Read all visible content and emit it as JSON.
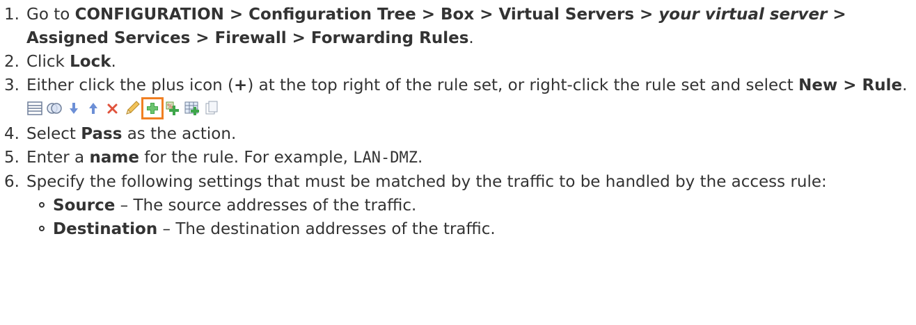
{
  "steps": [
    {
      "num": "1.",
      "lead": "Go to ",
      "path_bold_1": "CONFIGURATION > Configuration Tree > Box > Virtual Servers > ",
      "path_italic": "your virtual server",
      "path_bold_2": " > Assigned Services > Firewall > Forwarding Rules",
      "tail": "."
    },
    {
      "num": "2.",
      "lead": "Click ",
      "bold": "Lock",
      "tail": "."
    },
    {
      "num": "3.",
      "lead": "Either click the plus icon (",
      "plus": "+",
      "mid": ") at the top right of the rule set, or right-click the rule set and select ",
      "bold": "New > Rule",
      "tail": "."
    },
    {
      "num": "4.",
      "lead": "Select ",
      "bold": "Pass",
      "tail": " as the action."
    },
    {
      "num": "5.",
      "lead": "Enter a ",
      "bold": "name",
      "mid": " for the rule. For example, ",
      "code": "LAN-DMZ",
      "tail": "."
    },
    {
      "num": "6.",
      "text": "Specify the following settings that must be matched by the traffic to be handled by the access rule:"
    }
  ],
  "sub_items": [
    {
      "bold": "Source",
      "text": " – The source addresses of the traffic."
    },
    {
      "bold": "Destination",
      "text": " – The destination addresses of the traffic."
    }
  ],
  "toolbar_icons": [
    "list-view-icon",
    "merge-view-icon",
    "move-down-icon",
    "move-up-icon",
    "delete-icon",
    "edit-icon",
    "add-rule-icon",
    "add-group-icon",
    "add-table-icon",
    "copy-icon"
  ],
  "colors": {
    "text": "#333333",
    "highlight": "#f07f22",
    "arrow_blue": "#6c8fd6",
    "delete_red": "#e0533c",
    "plus_green": "#3ea64a"
  }
}
